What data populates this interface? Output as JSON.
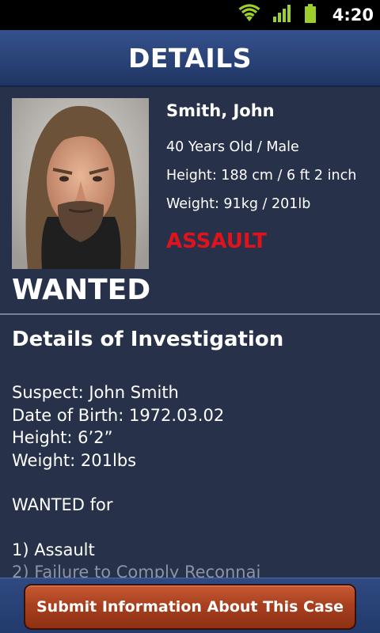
{
  "status_bar": {
    "time": "4:20",
    "icons": [
      "wifi-icon",
      "signal-icon",
      "battery-icon"
    ]
  },
  "header": {
    "title": "DETAILS"
  },
  "profile": {
    "name": "Smith, John",
    "age_gender": "40 Years Old / Male",
    "height": "Height: 188 cm / 6 ft 2 inch",
    "weight": "Weight: 91kg / 201lb",
    "crime": "ASSAULT",
    "status": "WANTED",
    "photo": "suspect-photo"
  },
  "investigation": {
    "title": "Details of Investigation",
    "suspect": "Suspect: John Smith",
    "dob": "Date of Birth: 1972.03.02",
    "height": "Height: 6’2”",
    "weight": "Weight: 201lbs",
    "wanted_for": "WANTED for",
    "charges": [
      "1) Assault",
      "2) Failure to Comply Reconnai"
    ]
  },
  "footer": {
    "submit_label": "Submit Information About This Case"
  },
  "colors": {
    "background": "#27314a",
    "crime": "#e0131c",
    "header": "#2b4479",
    "button": "#a8401f"
  }
}
